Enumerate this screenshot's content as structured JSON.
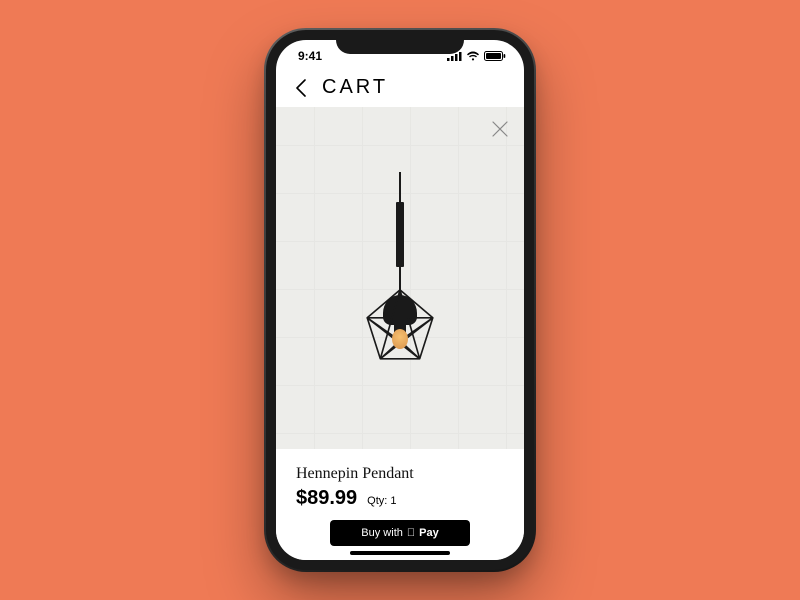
{
  "statusbar": {
    "time": "9:41"
  },
  "navbar": {
    "title": "CART"
  },
  "product": {
    "name": "Hennepin Pendant",
    "price": "$89.99",
    "qty_label": "Qty: 1"
  },
  "checkout": {
    "buy_prefix": "Buy with",
    "pay_brand": "Pay"
  }
}
